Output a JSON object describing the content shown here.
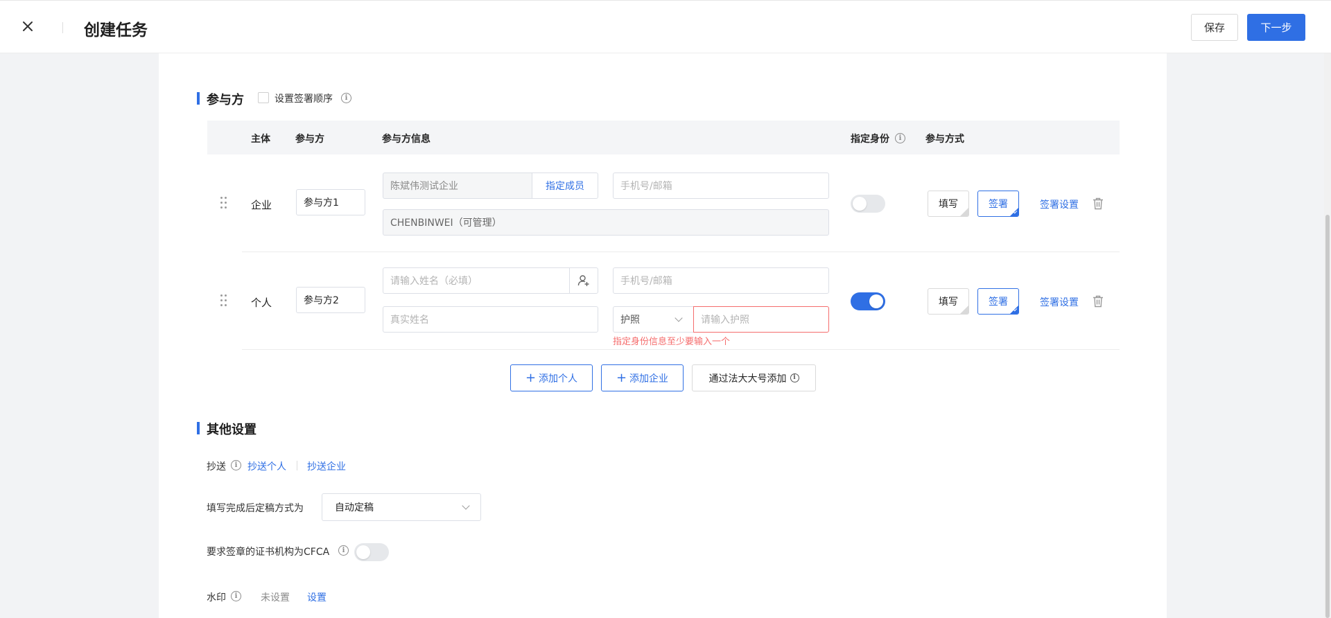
{
  "header": {
    "title": "创建任务",
    "save_label": "保存",
    "next_label": "下一步"
  },
  "participants": {
    "section_title": "参与方",
    "sign_order_label": "设置签署顺序",
    "columns": {
      "subject": "主体",
      "participant": "参与方",
      "info": "参与方信息",
      "designate_identity": "指定身份",
      "mode": "参与方式"
    },
    "rows": [
      {
        "subject": "企业",
        "name": "参与方1",
        "company": "陈斌伟测试企业",
        "assign_member_label": "指定成员",
        "contact_placeholder": "手机号/邮箱",
        "member": "CHENBINWEI（可管理）",
        "designate_identity_on": false,
        "fill_label": "填写",
        "sign_label": "签署",
        "sign_settings_label": "签署设置"
      },
      {
        "subject": "个人",
        "name": "参与方2",
        "name_placeholder": "请输入姓名（必填）",
        "contact_placeholder": "手机号/邮箱",
        "realname_placeholder": "真实姓名",
        "id_type": "护照",
        "id_placeholder": "请输入护照",
        "error_text": "指定身份信息至少要输入一个",
        "designate_identity_on": true,
        "fill_label": "填写",
        "sign_label": "签署",
        "sign_settings_label": "签署设置"
      }
    ],
    "add_person_label": "添加个人",
    "add_company_label": "添加企业",
    "add_by_fadada_label": "通过法大大号添加"
  },
  "other_settings": {
    "section_title": "其他设置",
    "cc_label": "抄送",
    "cc_person_label": "抄送个人",
    "cc_company_label": "抄送企业",
    "finalize_label": "填写完成后定稿方式为",
    "finalize_value": "自动定稿",
    "cfca_label": "要求签章的证书机构为CFCA",
    "cfca_on": false,
    "watermark_label": "水印",
    "watermark_status": "未设置",
    "watermark_set_label": "设置"
  },
  "colors": {
    "accent": "#2f6fe4",
    "error": "#f56c6c"
  }
}
